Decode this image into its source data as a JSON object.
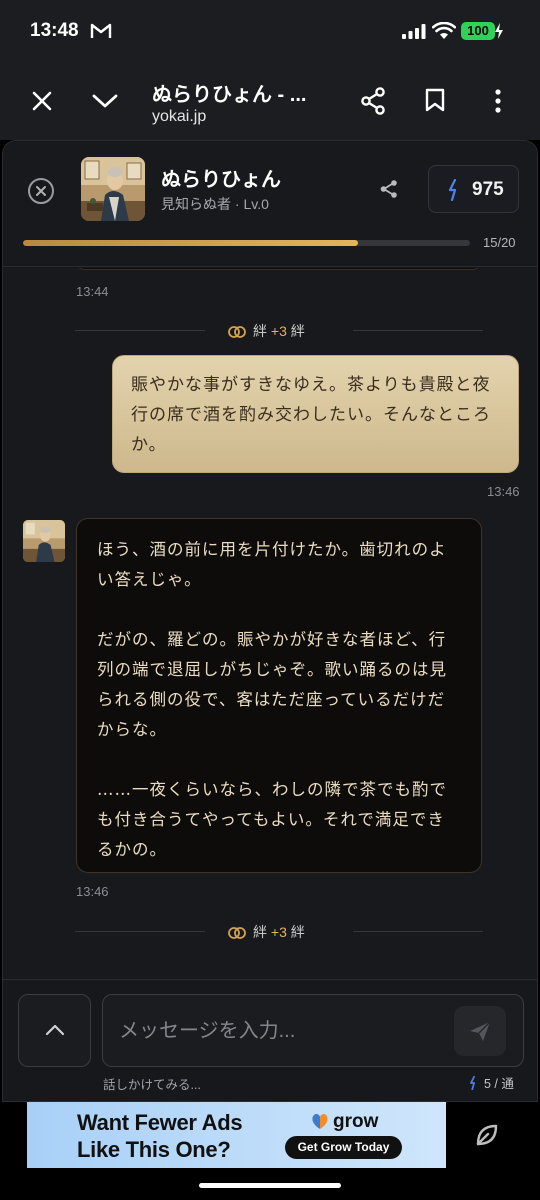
{
  "status_bar": {
    "time": "13:48",
    "battery": "100"
  },
  "browser": {
    "title": "ぬらりひょん - ...",
    "url": "yokai.jp"
  },
  "chat_header": {
    "name": "ぬらりひょん",
    "subtitle": "見知らぬ者 · Lv.0",
    "coins": "975",
    "progress_label": "15/20",
    "progress_fraction": 0.75
  },
  "messages": {
    "prev_timestamp": "13:44",
    "bond_1": {
      "label": "絆",
      "amount": "+3",
      "suffix": "絆"
    },
    "user_text": "賑やかな事がすきなゆえ。茶よりも貴殿と夜行の席で酒を酌み交わしたい。そんなところか。",
    "user_timestamp": "13:46",
    "char_paragraphs": [
      "ほう、酒の前に用を片付けたか。歯切れのよい答えじゃ。",
      "だがの、羅どの。賑やかが好きな者ほど、行列の端で退屈しがちじゃぞ。歌い踊るのは見られる側の役で、客はただ座っているだけだからな。",
      "……一夜くらいなら、わしの隣で茶でも酌でも付き合うてやってもよい。それで満足できるかの。"
    ],
    "char_timestamp": "13:46",
    "bond_2": {
      "label": "絆",
      "amount": "+3",
      "suffix": "絆"
    }
  },
  "composer": {
    "placeholder": "メッセージを入力...",
    "hint": "話しかけてみる...",
    "limit": "5 / 通"
  },
  "ad": {
    "headline": "Want Fewer Ads Like This One?",
    "brand": "grow",
    "cta": "Get Grow Today"
  },
  "colors": {
    "accent_gold": "#e0b25a",
    "user_bubble": "#dccaa0",
    "char_bubble_text": "#e9dcc0",
    "battery": "#30d158"
  }
}
